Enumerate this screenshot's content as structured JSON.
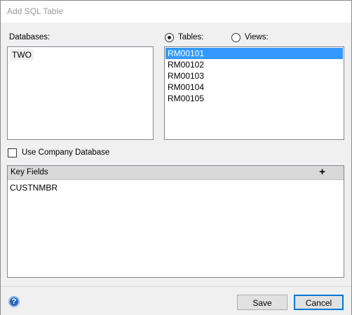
{
  "window": {
    "title": "Add SQL Table"
  },
  "databases": {
    "label": "Databases:",
    "items": [
      "TWO"
    ]
  },
  "object_type": {
    "tables_label": "Tables:",
    "views_label": "Views:",
    "selected": "Tables"
  },
  "tables": {
    "items": [
      "RM00101",
      "RM00102",
      "RM00103",
      "RM00104",
      "RM00105"
    ],
    "selected": "RM00101"
  },
  "options": {
    "use_company_db_label": "Use Company Database",
    "use_company_db_checked": false
  },
  "key_fields": {
    "header": "Key Fields",
    "add_symbol": "+",
    "items": [
      "CUSTNMBR"
    ]
  },
  "footer": {
    "help_symbol": "?",
    "save_label": "Save",
    "cancel_label": "Cancel"
  },
  "colors": {
    "selection": "#3399ff",
    "default_button_border": "#0078d7",
    "title_text": "#9a9a9a",
    "header_bg": "#d9d9d9",
    "help_icon": "#2a66b8"
  },
  "icons": {
    "help": "help-circle-icon",
    "add": "plus-icon"
  }
}
